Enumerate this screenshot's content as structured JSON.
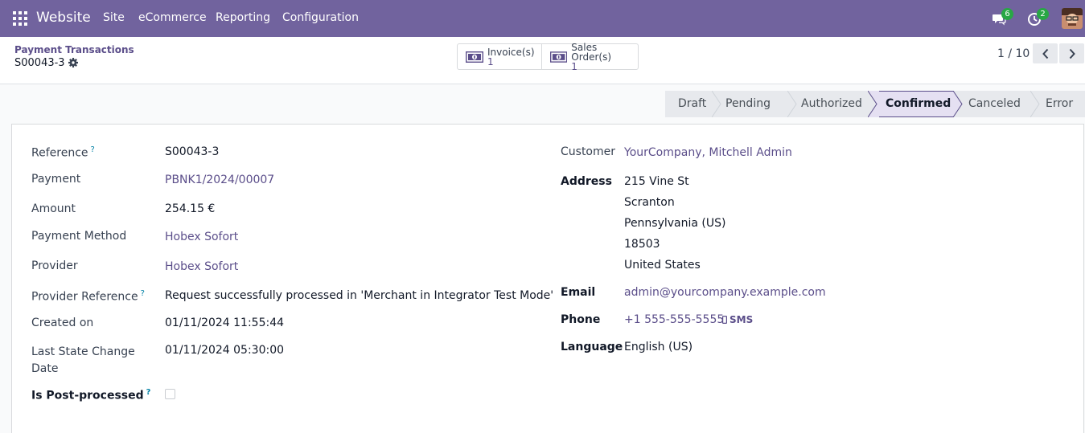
{
  "navbar": {
    "brand": "Website",
    "menu": [
      "Site",
      "eCommerce",
      "Reporting",
      "Configuration"
    ],
    "messages_count": "6",
    "activities_count": "2"
  },
  "control_panel": {
    "breadcrumb": "Payment Transactions",
    "record_name": "S00043-3",
    "smart_buttons": [
      {
        "label": "Invoice(s)",
        "count": "1"
      },
      {
        "label": "Sales Order(s)",
        "count": "1"
      }
    ],
    "pager": "1 / 10"
  },
  "statusbar": {
    "stages": [
      "Draft",
      "Pending",
      "Authorized",
      "Confirmed",
      "Canceled",
      "Error"
    ],
    "active": "Confirmed"
  },
  "form": {
    "left": {
      "reference_label": "Reference",
      "reference": "S00043-3",
      "payment_label": "Payment",
      "payment": "PBNK1/2024/00007",
      "amount_label": "Amount",
      "amount": "254.15 €",
      "payment_method_label": "Payment Method",
      "payment_method": "Hobex Sofort",
      "provider_label": "Provider",
      "provider": "Hobex Sofort",
      "provider_reference_label": "Provider Reference",
      "provider_reference": "Request successfully processed in 'Merchant in Integrator Test Mode'",
      "created_on_label": "Created on",
      "created_on": "01/11/2024 11:55:44",
      "last_state_change_label_1": "Last State Change",
      "last_state_change_label_2": "Date",
      "last_state_change": "01/11/2024 05:30:00",
      "is_post_processed_label": "Is Post-processed",
      "help_mark": "?"
    },
    "right": {
      "customer_label": "Customer",
      "customer": "YourCompany, Mitchell Admin",
      "address_label": "Address",
      "address_lines": [
        "215 Vine St",
        "Scranton",
        "Pennsylvania (US)",
        "18503",
        "United States"
      ],
      "email_label": "Email",
      "email": "admin@yourcompany.example.com",
      "phone_label": "Phone",
      "phone": "+1 555-555-5555",
      "sms_label": "SMS",
      "language_label": "Language",
      "language": "English (US)"
    }
  }
}
